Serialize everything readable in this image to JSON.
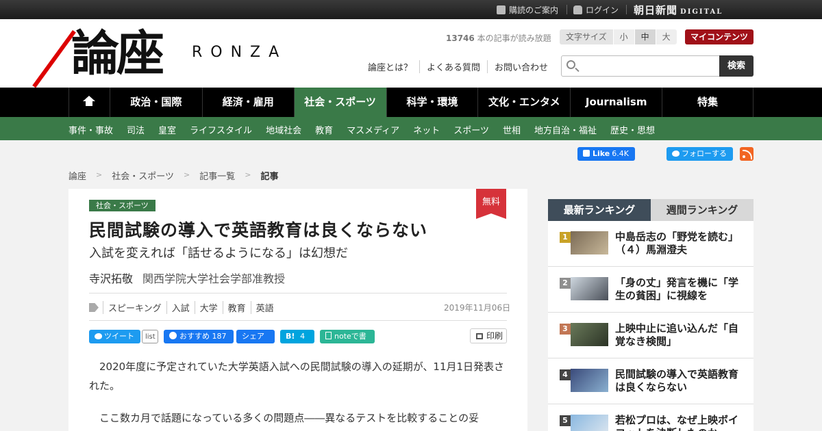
{
  "topbar": {
    "subscribe": "購読のご案内",
    "login": "ログイン",
    "brand_main": "朝日新聞",
    "brand_sub": "DIGITAL"
  },
  "header": {
    "logo_kanji": "論座",
    "logo_latin": "RONZA",
    "read_count_number": "13746",
    "read_count_text": " 本の記事が読み放題",
    "fontsize_label": "文字サイズ",
    "fontsize_options": [
      "小",
      "中",
      "大"
    ],
    "fontsize_selected": "中",
    "mycontents": "マイコンテンツ",
    "links": [
      "論座とは？",
      "よくある質問",
      "お問い合わせ"
    ],
    "search_placeholder": "",
    "search_button": "検索"
  },
  "mainnav": [
    "政治・国際",
    "経済・雇用",
    "社会・スポーツ",
    "科学・環境",
    "文化・エンタメ",
    "Journalism",
    "特集"
  ],
  "mainnav_active": "社会・スポーツ",
  "subnav": [
    "事件・事故",
    "司法",
    "皇室",
    "ライフスタイル",
    "地域社会",
    "教育",
    "マスメディア",
    "ネット",
    "スポーツ",
    "世相",
    "地方自治・福祉",
    "歴史・思想"
  ],
  "social": {
    "fb_like": "Like",
    "fb_like_count": "6.4K",
    "twitter_follow": "フォローする"
  },
  "breadcrumb": [
    "論座",
    "社会・スポーツ",
    "記事一覧",
    "記事"
  ],
  "article": {
    "category": "社会・スポーツ",
    "badge": "無料",
    "title": "民間試験の導入で英語教育は良くならない",
    "subtitle": "入試を変えれば「話せるようになる」は幻想だ",
    "author": "寺沢拓敬",
    "affiliation": "関西学院大学社会学部准教授",
    "tags": [
      "スピーキング",
      "入試",
      "大学",
      "教育",
      "英語"
    ],
    "date": "2019年11月06日",
    "share": {
      "tweet": "ツイート",
      "list": "list",
      "fb_recommend": "おすすめ",
      "fb_count": "187",
      "fb_share": "シェア",
      "hatena": "B!",
      "hatena_count": "4",
      "note": "noteで書く",
      "print": "印刷"
    },
    "paragraphs": [
      "2020年度に予定されていた大学英語入試への民間試験の導入の延期が、11月1日発表された。",
      "ここ数カ月で話題になっている多くの問題点――異なるテストを比較することの妥"
    ]
  },
  "ranking": {
    "tabs": [
      "最新ランキング",
      "週間ランキング"
    ],
    "active_tab": "最新ランキング",
    "items": [
      {
        "rank": "1",
        "title": "中島岳志の「野党を読む」（４）馬淵澄夫",
        "badge_color": "#c9a227",
        "thumb_colors": [
          "#7a6a55",
          "#c8b89a"
        ]
      },
      {
        "rank": "2",
        "title": "「身の丈」発言を機に「学生の貧困」に視線を",
        "badge_color": "#8f8f8f",
        "thumb_colors": [
          "#cfd8e0",
          "#4a4f58"
        ]
      },
      {
        "rank": "3",
        "title": "上映中止に追い込んだ「自覚なき検閲」",
        "badge_color": "#c27654",
        "thumb_colors": [
          "#6a7a5a",
          "#2b3325"
        ]
      },
      {
        "rank": "4",
        "title": "民間試験の導入で英語教育は良くならない",
        "badge_color": "#444444",
        "thumb_colors": [
          "#3a4a7a",
          "#8ab0d0"
        ]
      },
      {
        "rank": "5",
        "title": "若松プロは、なぜ上映ボイコットを決断したのか",
        "badge_color": "#444444",
        "thumb_colors": [
          "#8ab8e0",
          "#e0e8f0"
        ]
      }
    ]
  }
}
